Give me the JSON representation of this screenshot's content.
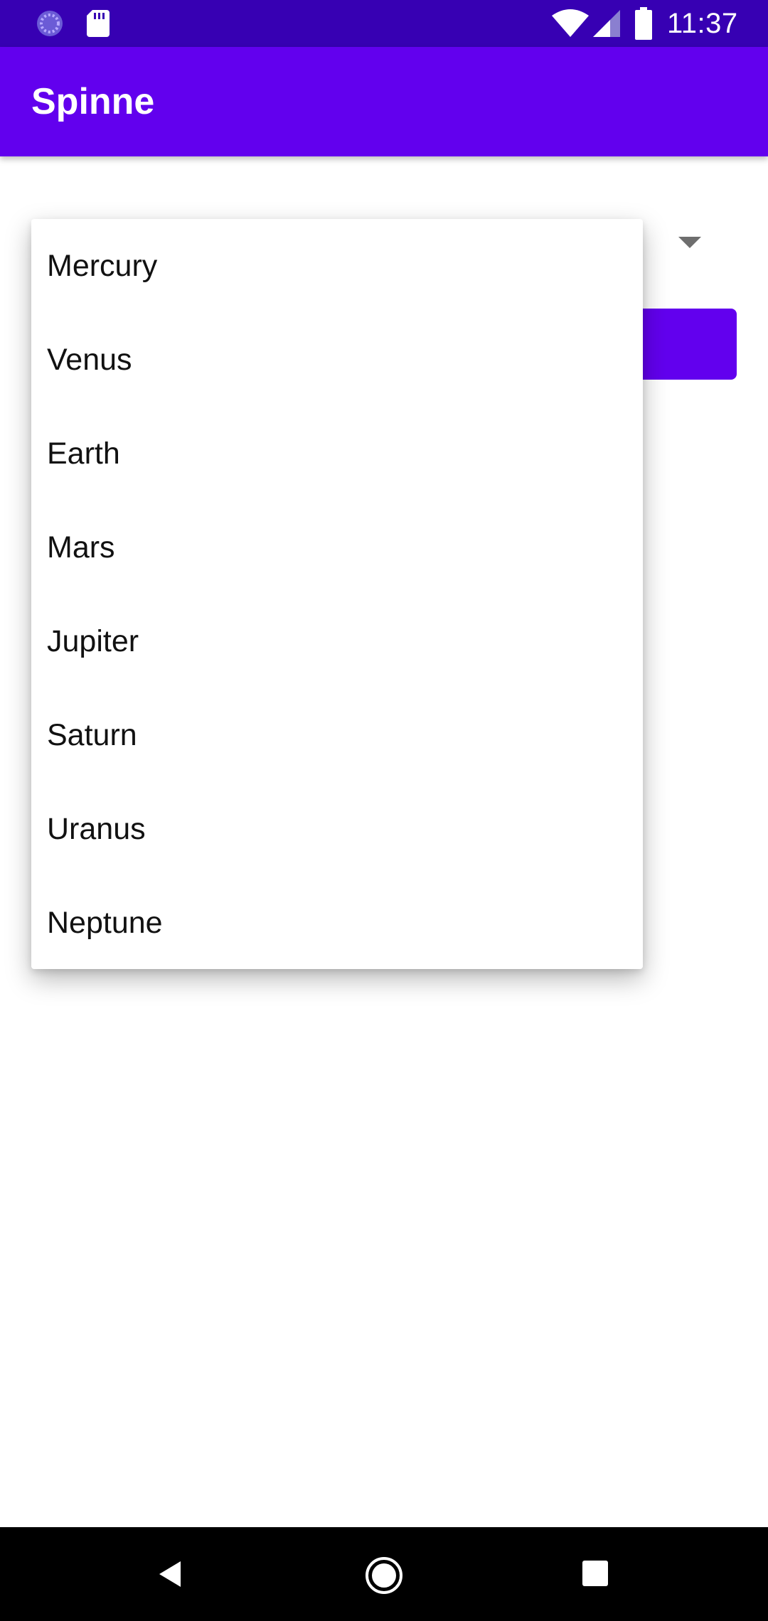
{
  "status_bar": {
    "time": "11:37",
    "icons": [
      "loader-icon",
      "sd-card-icon",
      "wifi-icon",
      "cell-signal-icon",
      "battery-icon"
    ],
    "background": "#3700b3"
  },
  "app_bar": {
    "title": "Spinne",
    "background": "#6200ee"
  },
  "spinner": {
    "options": [
      "Mercury",
      "Venus",
      "Earth",
      "Mars",
      "Jupiter",
      "Saturn",
      "Uranus",
      "Neptune"
    ],
    "expanded": true,
    "arrow_icon": "dropdown-arrow-icon"
  },
  "button": {
    "label": "",
    "background": "#6200ee"
  },
  "nav_bar": {
    "icons": [
      "back-icon",
      "home-icon",
      "recents-icon"
    ],
    "background": "#000000"
  }
}
